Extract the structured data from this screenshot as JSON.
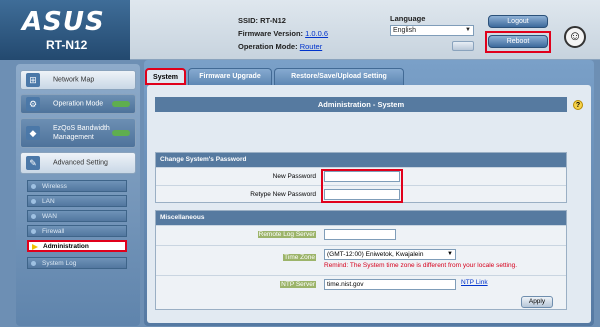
{
  "header": {
    "logo": "ASUS",
    "model": "RT-N12",
    "ssid_label": "SSID:",
    "ssid_value": "RT-N12",
    "firmware_label": "Firmware Version:",
    "firmware_value": "1.0.0.6",
    "opmode_label": "Operation Mode:",
    "opmode_value": "Router",
    "language_label": "Language",
    "language_value": "English",
    "logout_label": "Logout",
    "reboot_label": "Reboot"
  },
  "sidebar": {
    "main_items": [
      {
        "label": "Network Map",
        "icon": "network-map-icon"
      },
      {
        "label": "Operation Mode",
        "icon": "operation-mode-icon"
      },
      {
        "label": "EzQoS Bandwidth Management",
        "icon": "qos-icon"
      },
      {
        "label": "Advanced Setting",
        "icon": "tools-icon"
      }
    ],
    "sub_items": [
      "Wireless",
      "LAN",
      "WAN",
      "Firewall",
      "Administration",
      "System Log"
    ],
    "active_sub_item": "Administration"
  },
  "tabs": [
    "System",
    "Firmware Upgrade",
    "Restore/Save/Upload Setting"
  ],
  "active_tab": "System",
  "panel": {
    "title": "Administration - System",
    "password_section": {
      "heading": "Change System's Password",
      "new_password_label": "New Password",
      "retype_label": "Retype New Password",
      "new_password_value": "",
      "retype_value": ""
    },
    "misc_section": {
      "heading": "Miscellaneous",
      "remote_log_label": "Remote Log Server",
      "remote_log_value": "",
      "timezone_label": "Time Zone",
      "timezone_value": "(GMT-12:00) Eniwetok, Kwajalein",
      "timezone_remind": "Remind: The System time zone is different from your locale setting.",
      "ntp_label": "NTP Server",
      "ntp_value": "time.nist.gov",
      "ntp_link": "NTP Link"
    },
    "apply_label": "Apply"
  },
  "colors": {
    "highlight_red": "#e0001b",
    "header_blue": "#567aa0",
    "remind_red": "#d6001c"
  }
}
